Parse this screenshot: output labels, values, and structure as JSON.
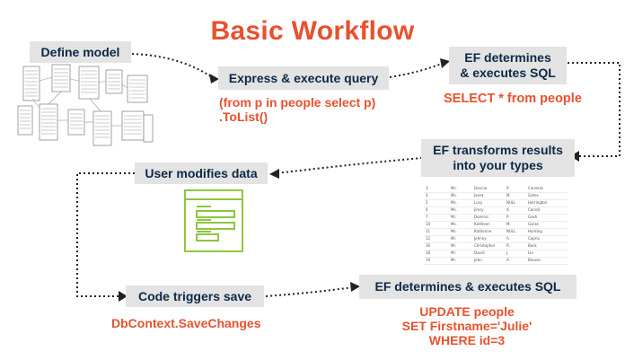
{
  "title": "Basic Workflow",
  "boxes": {
    "define_model": "Define model",
    "express_query": "Express & execute query",
    "ef_determines_1": "EF determines",
    "ef_determines_2": "& executes SQL",
    "ef_transforms_1": "EF transforms results",
    "ef_transforms_2": "into your types",
    "user_modifies": "User modifies data",
    "code_triggers": "Code triggers save",
    "ef_determines_save": "EF determines & executes SQL"
  },
  "code": {
    "query_line1": "(from p in people select p)",
    "query_line2": ".ToList()",
    "select_sql": "SELECT * from people",
    "save_changes": "DbContext.SaveChanges",
    "update_line1": "UPDATE people",
    "update_line2": "SET Firstname='Julie'",
    "update_line3": "WHERE id=3"
  },
  "colors": {
    "accent": "#e8512f",
    "box_bg": "#e3e3e3",
    "box_text": "#0d2846",
    "form_icon": "#8dc63f"
  },
  "icons": [
    "schema-diagram-icon",
    "form-icon",
    "result-table-icon"
  ],
  "result_table": {
    "rows": [
      [
        "3",
        "Ms.",
        "Donnie",
        "P.",
        "Carreras"
      ],
      [
        "4",
        "Ms.",
        "Janet",
        "M.",
        "Gates"
      ],
      [
        "5",
        "Ms.",
        "Lucy",
        "NULL",
        "Harrington"
      ],
      [
        "6",
        "Ms.",
        "Jimsy",
        "X.",
        "Carroll"
      ],
      [
        "7",
        "Mr.",
        "Dominic",
        "P.",
        "Gash"
      ],
      [
        "10",
        "Ms.",
        "Kathleen",
        "M.",
        "Garza"
      ],
      [
        "11",
        "Ms.",
        "Katherine",
        "NULL",
        "Harding"
      ],
      [
        "12",
        "Mr.",
        "Johnny",
        "A.",
        "Caprio"
      ],
      [
        "16",
        "Mr.",
        "Christopher",
        "R.",
        "Beck"
      ],
      [
        "18",
        "Mr.",
        "David",
        "J.",
        "Liu"
      ],
      [
        "19",
        "Mr.",
        "John",
        "A.",
        "Beaver"
      ]
    ]
  }
}
